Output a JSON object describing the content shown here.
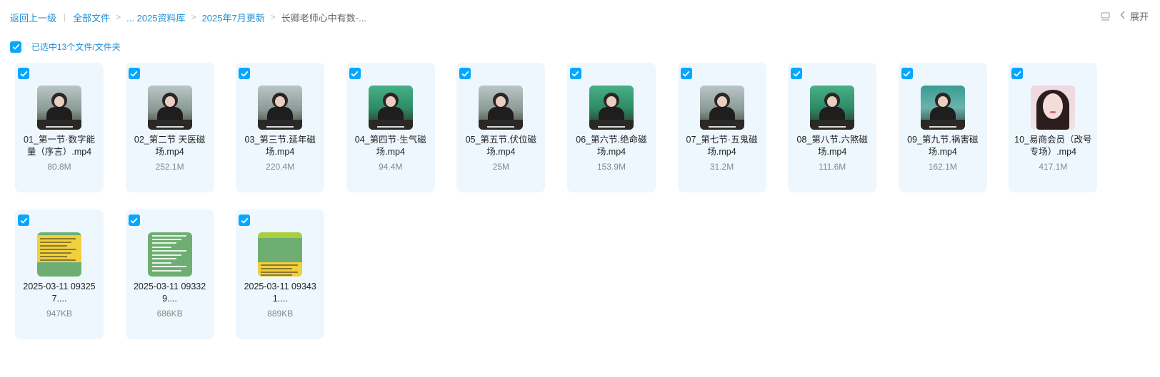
{
  "breadcrumb": {
    "back": "返回上一级",
    "all_files": "全部文件",
    "sep": ">",
    "level1": "... 2025资料库",
    "level2": "2025年7月更新",
    "current": "长卿老师心中有数-..."
  },
  "toolbar": {
    "expand_label": "展开",
    "list_icon": "list-view-icon",
    "collapse_icon": "chevron-left-icon"
  },
  "selection": {
    "label": "已选中13个文件/文件夹"
  },
  "files": [
    {
      "name": "01_第一节·数字能量（序言）.mp4",
      "size": "80.8M",
      "kind": "video",
      "thumb": "vid"
    },
    {
      "name": "02_第二节 天医磁场.mp4",
      "size": "252.1M",
      "kind": "video",
      "thumb": "vid"
    },
    {
      "name": "03_第三节.延年磁场.mp4",
      "size": "220.4M",
      "kind": "video",
      "thumb": "vid"
    },
    {
      "name": "04_第四节·生气磁场.mp4",
      "size": "94.4M",
      "kind": "video",
      "thumb": "vid green"
    },
    {
      "name": "05_第五节.伏位磁场.mp4",
      "size": "25M",
      "kind": "video",
      "thumb": "vid"
    },
    {
      "name": "06_第六节.绝命磁场.mp4",
      "size": "153.9M",
      "kind": "video",
      "thumb": "vid green"
    },
    {
      "name": "07_第七节·五鬼磁场.mp4",
      "size": "31.2M",
      "kind": "video",
      "thumb": "vid"
    },
    {
      "name": "08_第八节.六煞磁场.mp4",
      "size": "111.6M",
      "kind": "video",
      "thumb": "vid green"
    },
    {
      "name": "09_第九节.祸害磁场.mp4",
      "size": "162.1M",
      "kind": "video",
      "thumb": "vid teal"
    },
    {
      "name": "10_易商会员（改号专场）.mp4",
      "size": "417.1M",
      "kind": "video",
      "thumb": "portrait"
    },
    {
      "name": "2025-03-11 093257....",
      "size": "947KB",
      "kind": "image",
      "thumb": "shot yellow"
    },
    {
      "name": "2025-03-11 093329....",
      "size": "686KB",
      "kind": "image",
      "thumb": "shot green"
    },
    {
      "name": "2025-03-11 093431....",
      "size": "889KB",
      "kind": "image",
      "thumb": "shot yellow2"
    }
  ],
  "colors": {
    "accent": "#06a7ff",
    "link": "#1e8fd6",
    "card_bg": "#eef7fd"
  }
}
